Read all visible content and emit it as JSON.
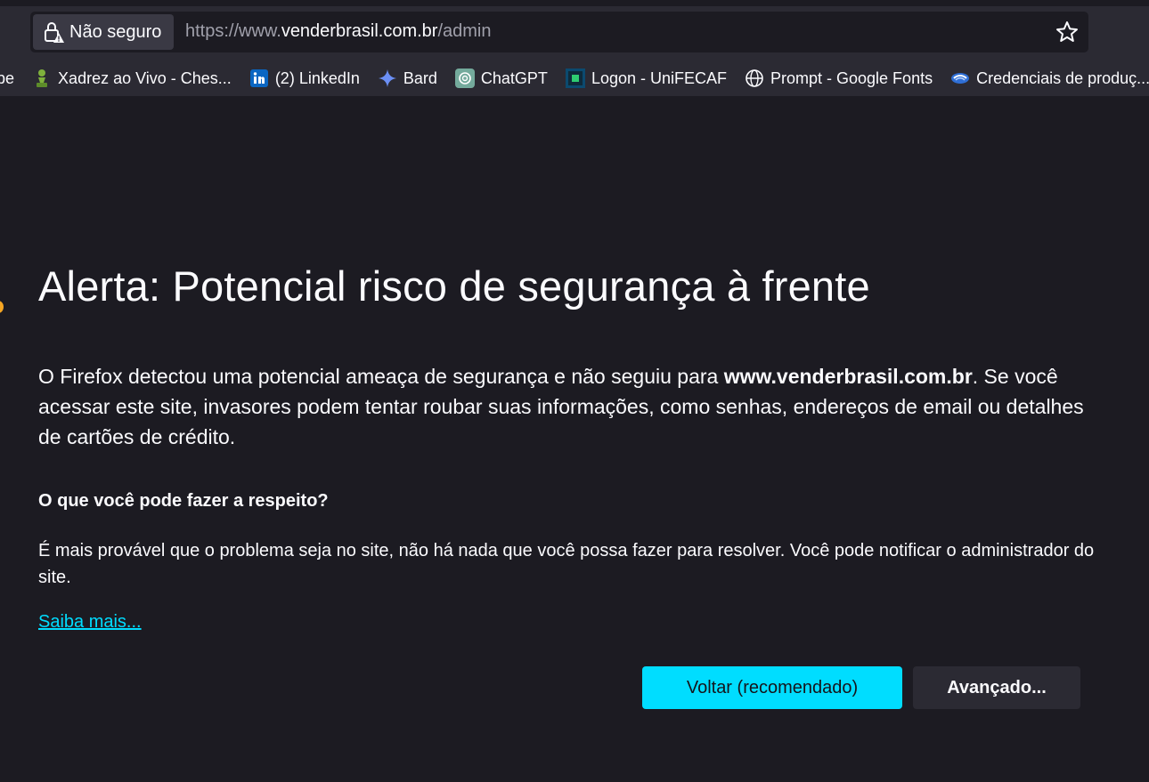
{
  "address_bar": {
    "security_label": "Não seguro",
    "url_prefix": "https://www.",
    "url_host": "venderbrasil.com.br",
    "url_path": "/admin",
    "lock_icon": "lock-warning-icon",
    "star_icon": "star-icon"
  },
  "bookmarks": [
    {
      "label": "ube",
      "icon": ""
    },
    {
      "label": "Xadrez ao Vivo - Ches...",
      "icon": "chess-pawn-icon"
    },
    {
      "label": "(2) LinkedIn",
      "icon": "linkedin-icon"
    },
    {
      "label": "Bard",
      "icon": "bard-sparkle-icon"
    },
    {
      "label": "ChatGPT",
      "icon": "chatgpt-icon"
    },
    {
      "label": "Logon - UniFECAF",
      "icon": "unifecaf-icon"
    },
    {
      "label": "Prompt - Google Fonts",
      "icon": "globe-icon"
    },
    {
      "label": "Credenciais de produç...",
      "icon": "handshake-icon"
    }
  ],
  "error_page": {
    "title": "Alerta: Potencial risco de segurança à frente",
    "intro_before": "O Firefox detectou uma potencial ameaça de segurança e não seguiu para ",
    "intro_host": "www.venderbrasil.com.br",
    "intro_after": ". Se você acessar este site, invasores podem tentar roubar suas informações, como senhas, endereços de email ou detalhes de cartões de crédito.",
    "what_heading": "O que você pode fazer a respeito?",
    "what_text": "É mais provável que o problema seja no site, não há nada que você possa fazer para resolver. Você pode notificar o administrador do site.",
    "learn_more": "Saiba mais...",
    "back_button": "Voltar (recomendado)",
    "advanced_button": "Avançado..."
  },
  "colors": {
    "page_background": "#1c1b22",
    "toolbar_background": "#2b2a33",
    "accent": "#00ddff",
    "text": "#fbfbfe"
  }
}
